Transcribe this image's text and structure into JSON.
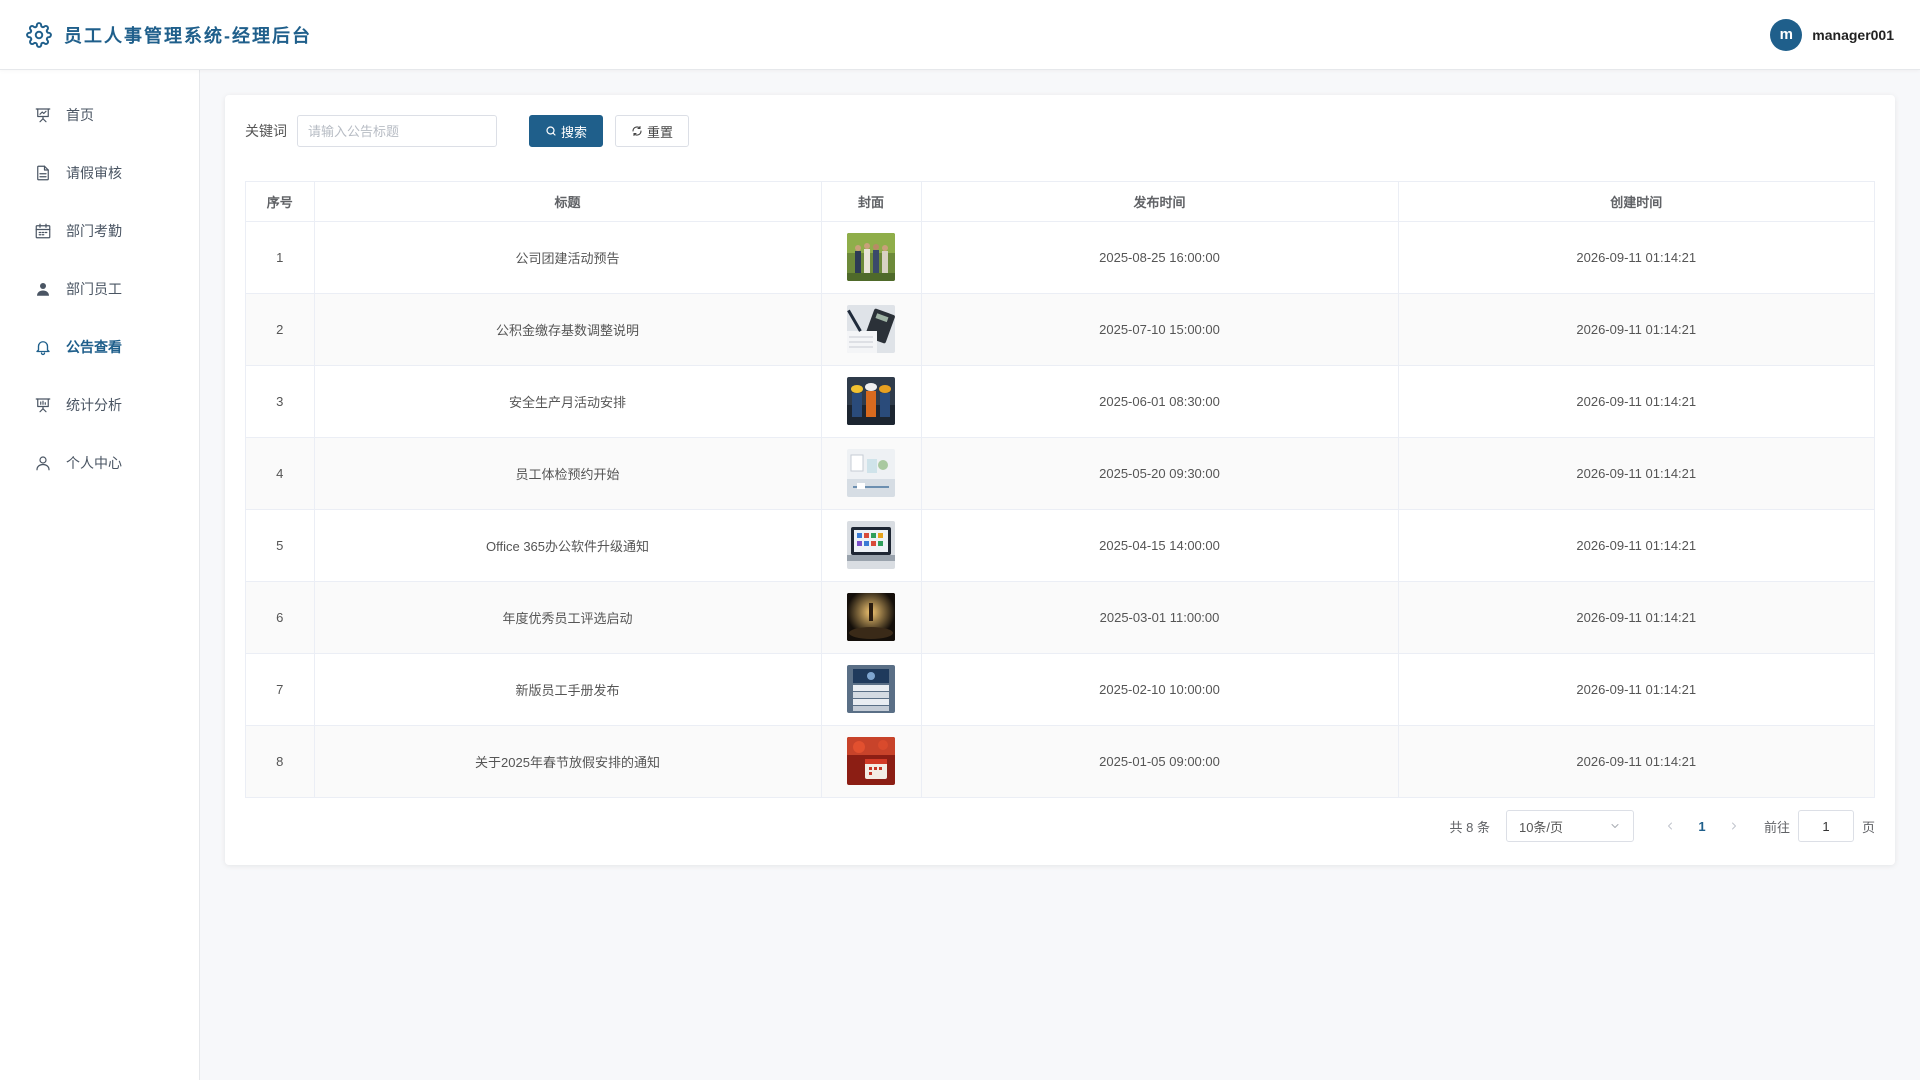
{
  "header": {
    "title": "员工人事管理系统-经理后台",
    "avatar_letter": "m",
    "username": "manager001"
  },
  "sidebar": {
    "items": [
      {
        "label": "首页",
        "icon": "presentation-icon",
        "active": false
      },
      {
        "label": "请假审核",
        "icon": "document-icon",
        "active": false
      },
      {
        "label": "部门考勤",
        "icon": "calendar-icon",
        "active": false
      },
      {
        "label": "部门员工",
        "icon": "user-filled-icon",
        "active": false
      },
      {
        "label": "公告查看",
        "icon": "bell-icon",
        "active": true
      },
      {
        "label": "统计分析",
        "icon": "chart-board-icon",
        "active": false
      },
      {
        "label": "个人中心",
        "icon": "user-outline-icon",
        "active": false
      }
    ]
  },
  "search": {
    "label": "关键词",
    "placeholder": "请输入公告标题",
    "value": "",
    "search_button": "搜索",
    "reset_button": "重置"
  },
  "table": {
    "columns": [
      "序号",
      "标题",
      "封面",
      "发布时间",
      "创建时间"
    ],
    "rows": [
      {
        "index": "1",
        "title": "公司团建活动预告",
        "cover": "team-photo",
        "publish_time": "2025-08-25 16:00:00",
        "create_time": "2026-09-11 01:14:21"
      },
      {
        "index": "2",
        "title": "公积金缴存基数调整说明",
        "cover": "calculator-photo",
        "publish_time": "2025-07-10 15:00:00",
        "create_time": "2026-09-11 01:14:21"
      },
      {
        "index": "3",
        "title": "安全生产月活动安排",
        "cover": "workers-photo",
        "publish_time": "2025-06-01 08:30:00",
        "create_time": "2026-09-11 01:14:21"
      },
      {
        "index": "4",
        "title": "员工体检预约开始",
        "cover": "clinic-photo",
        "publish_time": "2025-05-20 09:30:00",
        "create_time": "2026-09-11 01:14:21"
      },
      {
        "index": "5",
        "title": "Office 365办公软件升级通知",
        "cover": "laptop-photo",
        "publish_time": "2025-04-15 14:00:00",
        "create_time": "2026-09-11 01:14:21"
      },
      {
        "index": "6",
        "title": "年度优秀员工评选启动",
        "cover": "stage-photo",
        "publish_time": "2025-03-01 11:00:00",
        "create_time": "2026-09-11 01:14:21"
      },
      {
        "index": "7",
        "title": "新版员工手册发布",
        "cover": "handbook-photo",
        "publish_time": "2025-02-10 10:00:00",
        "create_time": "2026-09-11 01:14:21"
      },
      {
        "index": "8",
        "title": "关于2025年春节放假安排的通知",
        "cover": "festival-photo",
        "publish_time": "2025-01-05 09:00:00",
        "create_time": "2026-09-11 01:14:21"
      }
    ]
  },
  "pagination": {
    "total_text": "共 8 条",
    "page_size": "10条/页",
    "current_page": "1",
    "goto_label": "前往",
    "goto_value": "1",
    "page_suffix": "页"
  },
  "colors": {
    "accent": "#1f5f8b"
  }
}
